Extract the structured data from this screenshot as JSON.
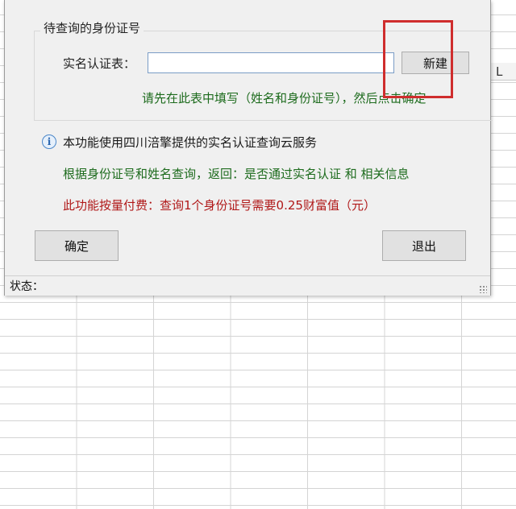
{
  "spreadsheet": {
    "column_header": "L"
  },
  "dialog": {
    "group_title": "待查询的身份证号",
    "name_label": "实名认证表：",
    "name_input_value": "",
    "new_button": "新建",
    "hint": "请先在此表中填写（姓名和身份证号），然后点击确定",
    "info_icon_glyph": "i",
    "info_text": "本功能使用四川涪擎提供的实名认证查询云服务",
    "query_text": "根据身份证号和姓名查询，返回：是否通过实名认证 和 相关信息",
    "fee_text": "此功能按量付费：查询1个身份证号需要0.25财富值（元）",
    "ok_button": "确定",
    "exit_button": "退出",
    "status_label": "状态："
  },
  "colors": {
    "hint_green": "#1d6b1d",
    "fee_red": "#b01818",
    "highlight_red": "#cf2d2d",
    "dialog_bg": "#f0f0f0"
  },
  "icons": [
    "info-icon",
    "resize-grip-icon"
  ]
}
